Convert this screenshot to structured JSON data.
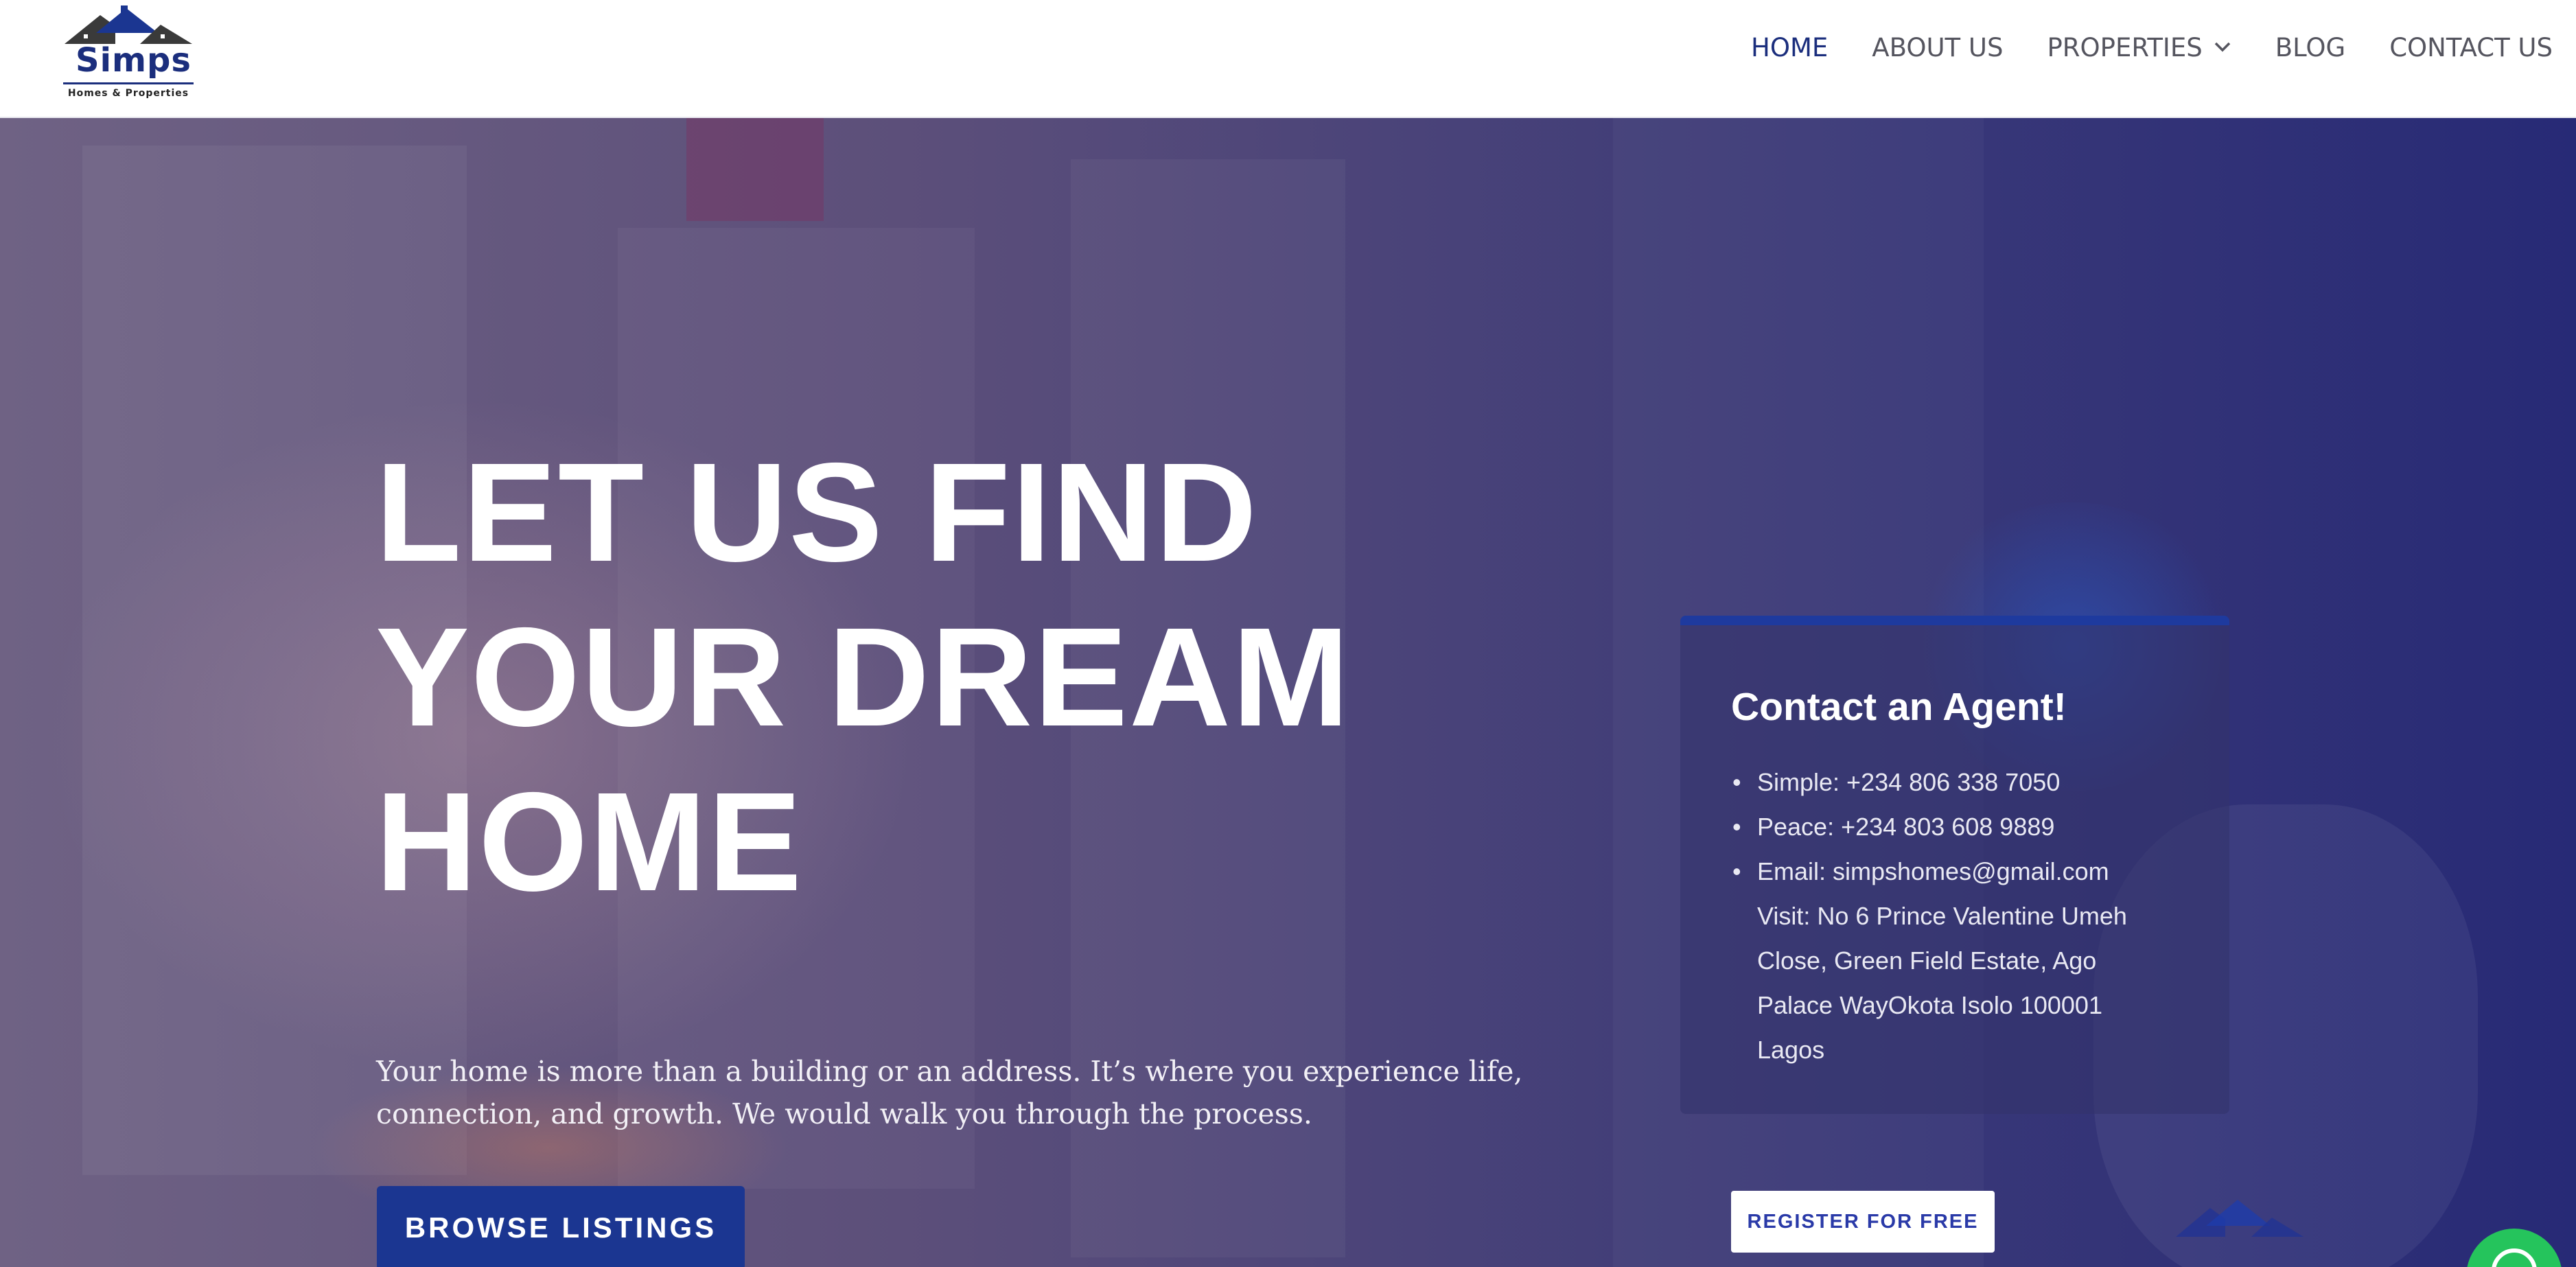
{
  "brand": {
    "name": "Simps",
    "tagline": "Homes & Properties",
    "colors": {
      "primary": "#1b2e7d",
      "button": "#1b3691",
      "chat": "#25c45c"
    }
  },
  "nav": {
    "items": [
      {
        "label": "HOME",
        "active": true
      },
      {
        "label": "ABOUT US",
        "active": false
      },
      {
        "label": "PROPERTIES",
        "active": false,
        "has_dropdown": true
      },
      {
        "label": "BLOG",
        "active": false
      },
      {
        "label": "CONTACT US",
        "active": false
      }
    ],
    "dropdown_icon": "chevron-down-icon"
  },
  "hero": {
    "title_lines": [
      "LET US FIND",
      "YOUR DREAM",
      "HOME"
    ],
    "subtitle": "Your home is more than a building or an address. It’s where you experience life, connection, and growth. We would walk you through the process.",
    "cta_label": "BROWSE LISTINGS"
  },
  "contact_card": {
    "title": "Contact an Agent!",
    "items": [
      "Simple: +234 806 338 7050",
      "Peace: +234 803 608 9889",
      "Email: simpshomes@gmail.com"
    ],
    "visit": "Visit: No 6 Prince Valentine Umeh Close, Green Field Estate, Ago Palace WayOkota Isolo 100001 Lagos",
    "register_label": "REGISTER FOR FREE"
  },
  "chat_widget": {
    "icon": "whatsapp-icon"
  }
}
